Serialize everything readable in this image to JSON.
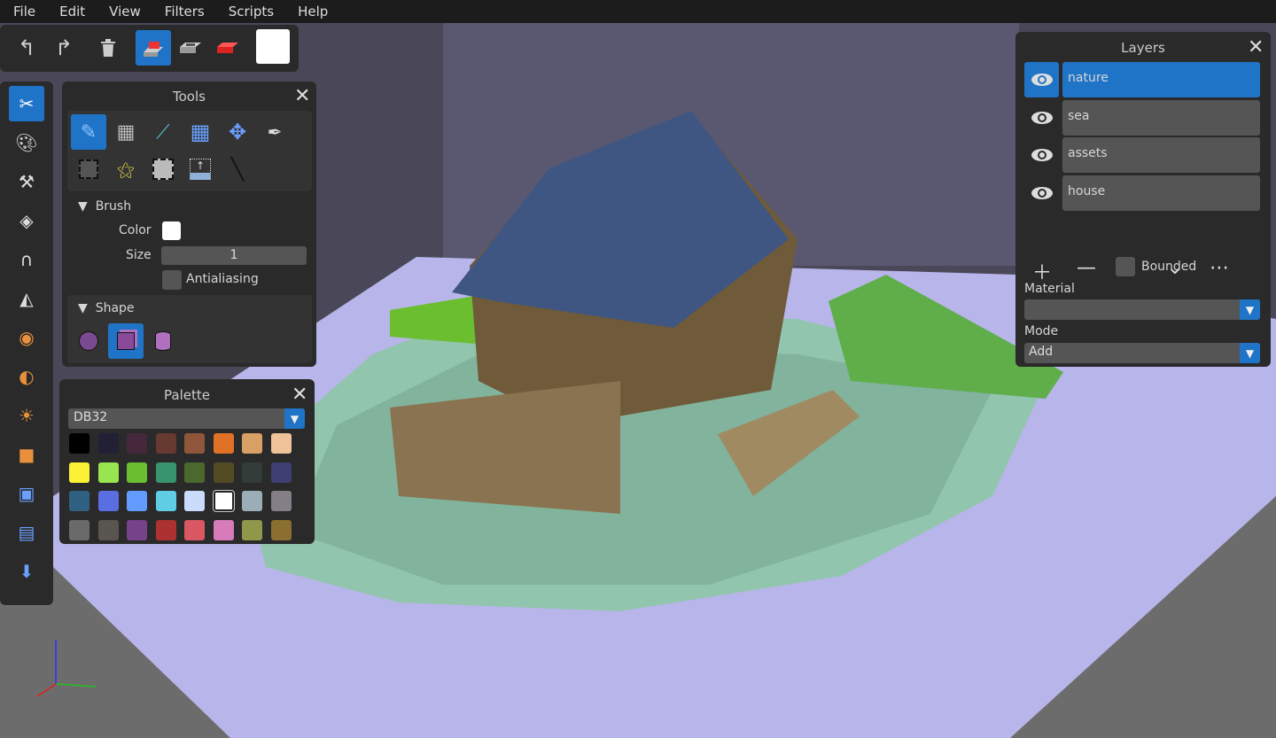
{
  "menu": [
    "File",
    "Edit",
    "View",
    "Filters",
    "Scripts",
    "Help"
  ],
  "toolbar": {
    "items": [
      "undo-icon",
      "redo-icon",
      "trash-icon",
      "add-mode-icon",
      "sub-mode-icon",
      "paint-mode-icon"
    ],
    "selected": "add-mode-icon",
    "current_color": "#ffffff"
  },
  "sidebar": {
    "items": [
      "tools-icon",
      "palette-icon",
      "hammer-icon",
      "layers-icon",
      "magnet-icon",
      "symmetry-icon",
      "view-icon",
      "material-icon",
      "light-icon",
      "camera-icon",
      "image-icon",
      "film-icon",
      "export-icon"
    ],
    "selected": "tools-icon"
  },
  "tools": {
    "title": "Tools",
    "selected": "pencil",
    "brush": {
      "heading": "Brush",
      "color_label": "Color",
      "color": "#ffffff",
      "size_label": "Size",
      "size": "1",
      "antialiasing_label": "Antialiasing",
      "antialiasing": false
    },
    "shape": {
      "heading": "Shape",
      "options": [
        "sphere",
        "cube",
        "cylinder"
      ],
      "selected": "cube"
    }
  },
  "palette": {
    "title": "Palette",
    "selected_palette": "DB32",
    "selected_color": "#ffffff",
    "colors": [
      "#000000",
      "#222034",
      "#45283c",
      "#663931",
      "#8f563b",
      "#df7126",
      "#d9a066",
      "#eec39a",
      "#fbf236",
      "#99e550",
      "#6abe30",
      "#37946e",
      "#4b692f",
      "#524b24",
      "#323c39",
      "#3f3f74",
      "#306082",
      "#5b6ee1",
      "#639bff",
      "#5fcde4",
      "#cbdbfc",
      "#ffffff",
      "#9badb7",
      "#847e87",
      "#696a6a",
      "#595652",
      "#76428a",
      "#ac3232",
      "#d95763",
      "#d77bba",
      "#8f974a",
      "#8a6f30"
    ]
  },
  "layers": {
    "title": "Layers",
    "items": [
      {
        "name": "nature",
        "selected": true
      },
      {
        "name": "sea"
      },
      {
        "name": "assets"
      },
      {
        "name": "house"
      }
    ],
    "bounded_label": "Bounded",
    "material_label": "Material",
    "material_value": "",
    "mode_label": "Mode",
    "mode_value": "Add"
  },
  "colors": {
    "accent": "#1f74c7",
    "panel": "#2a2a2a"
  }
}
